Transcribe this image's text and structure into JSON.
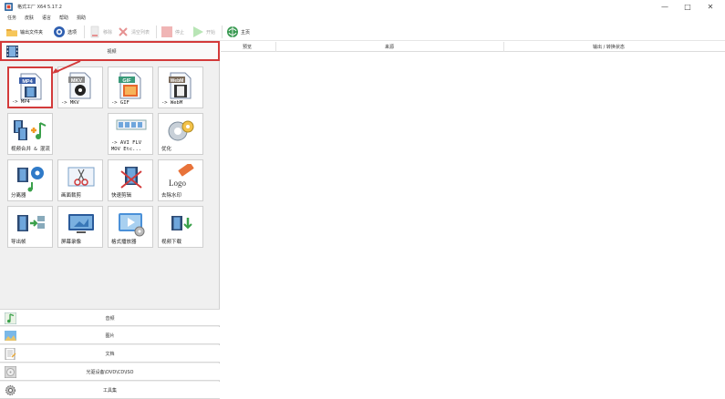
{
  "window": {
    "title": "格式工厂 X64 5.17.2",
    "controls": [
      "—",
      "□",
      "✕"
    ]
  },
  "menu": [
    "任务",
    "皮肤",
    "语言",
    "帮助",
    "捐助"
  ],
  "toolbar": [
    {
      "label": "输出文件夹",
      "icon": "folder-icon",
      "enabled": true
    },
    {
      "label": "选项",
      "icon": "options-icon",
      "enabled": true
    },
    {
      "label": "移除",
      "icon": "remove-icon",
      "enabled": false
    },
    {
      "label": "清空列表",
      "icon": "clear-list-icon",
      "enabled": false
    },
    {
      "label": "停止",
      "icon": "stop-icon",
      "enabled": false
    },
    {
      "label": "开始",
      "icon": "start-icon",
      "enabled": false
    },
    {
      "label": "主页",
      "icon": "home-icon",
      "enabled": true
    }
  ],
  "categories": {
    "video": "视频",
    "audio": "音频",
    "picture": "图片",
    "document": "文档",
    "disc": "光驱设备\\DVD\\CD\\ISO",
    "toolbox": "工具集"
  },
  "tiles": [
    {
      "label": "-> MP4",
      "badge": "MP4",
      "icon": "mp4-icon",
      "selected": true
    },
    {
      "label": "-> MKV",
      "badge": "MKV",
      "icon": "mkv-icon",
      "selected": false
    },
    {
      "label": "-> GIF",
      "badge": "GIF",
      "icon": "gif-icon",
      "selected": false
    },
    {
      "label": "-> WebM",
      "badge": "WebM",
      "icon": "webm-icon",
      "selected": false
    },
    {
      "label": "视频合并 & 混流",
      "icon": "merge-icon",
      "selected": false
    },
    {
      "label": "-> AVI FLV",
      "label2": "MOV Etc...",
      "icon": "avi-flv-icon",
      "selected": false
    },
    {
      "label": "优化",
      "icon": "optimize-icon",
      "selected": false
    },
    {
      "label": "分离器",
      "icon": "splitter-icon",
      "selected": false
    },
    {
      "label": "画面裁剪",
      "icon": "crop-icon",
      "selected": false
    },
    {
      "label": "快速剪辑",
      "icon": "quick-clip-icon",
      "selected": false
    },
    {
      "label": "去除水印",
      "badge": "Logo",
      "icon": "remove-watermark-icon",
      "selected": false
    },
    {
      "label": "导出帧",
      "icon": "export-frames-icon",
      "selected": false
    },
    {
      "label": "屏幕录像",
      "icon": "screen-record-icon",
      "selected": false
    },
    {
      "label": "格式播放器",
      "icon": "format-player-icon",
      "selected": false
    },
    {
      "label": "视频下载",
      "icon": "video-download-icon",
      "selected": false
    }
  ],
  "task_table": {
    "columns": [
      "预览",
      "来源",
      "输出 / 转换状态"
    ]
  },
  "colors": {
    "highlight": "#d33a3a",
    "panel": "#f0f0f0"
  }
}
